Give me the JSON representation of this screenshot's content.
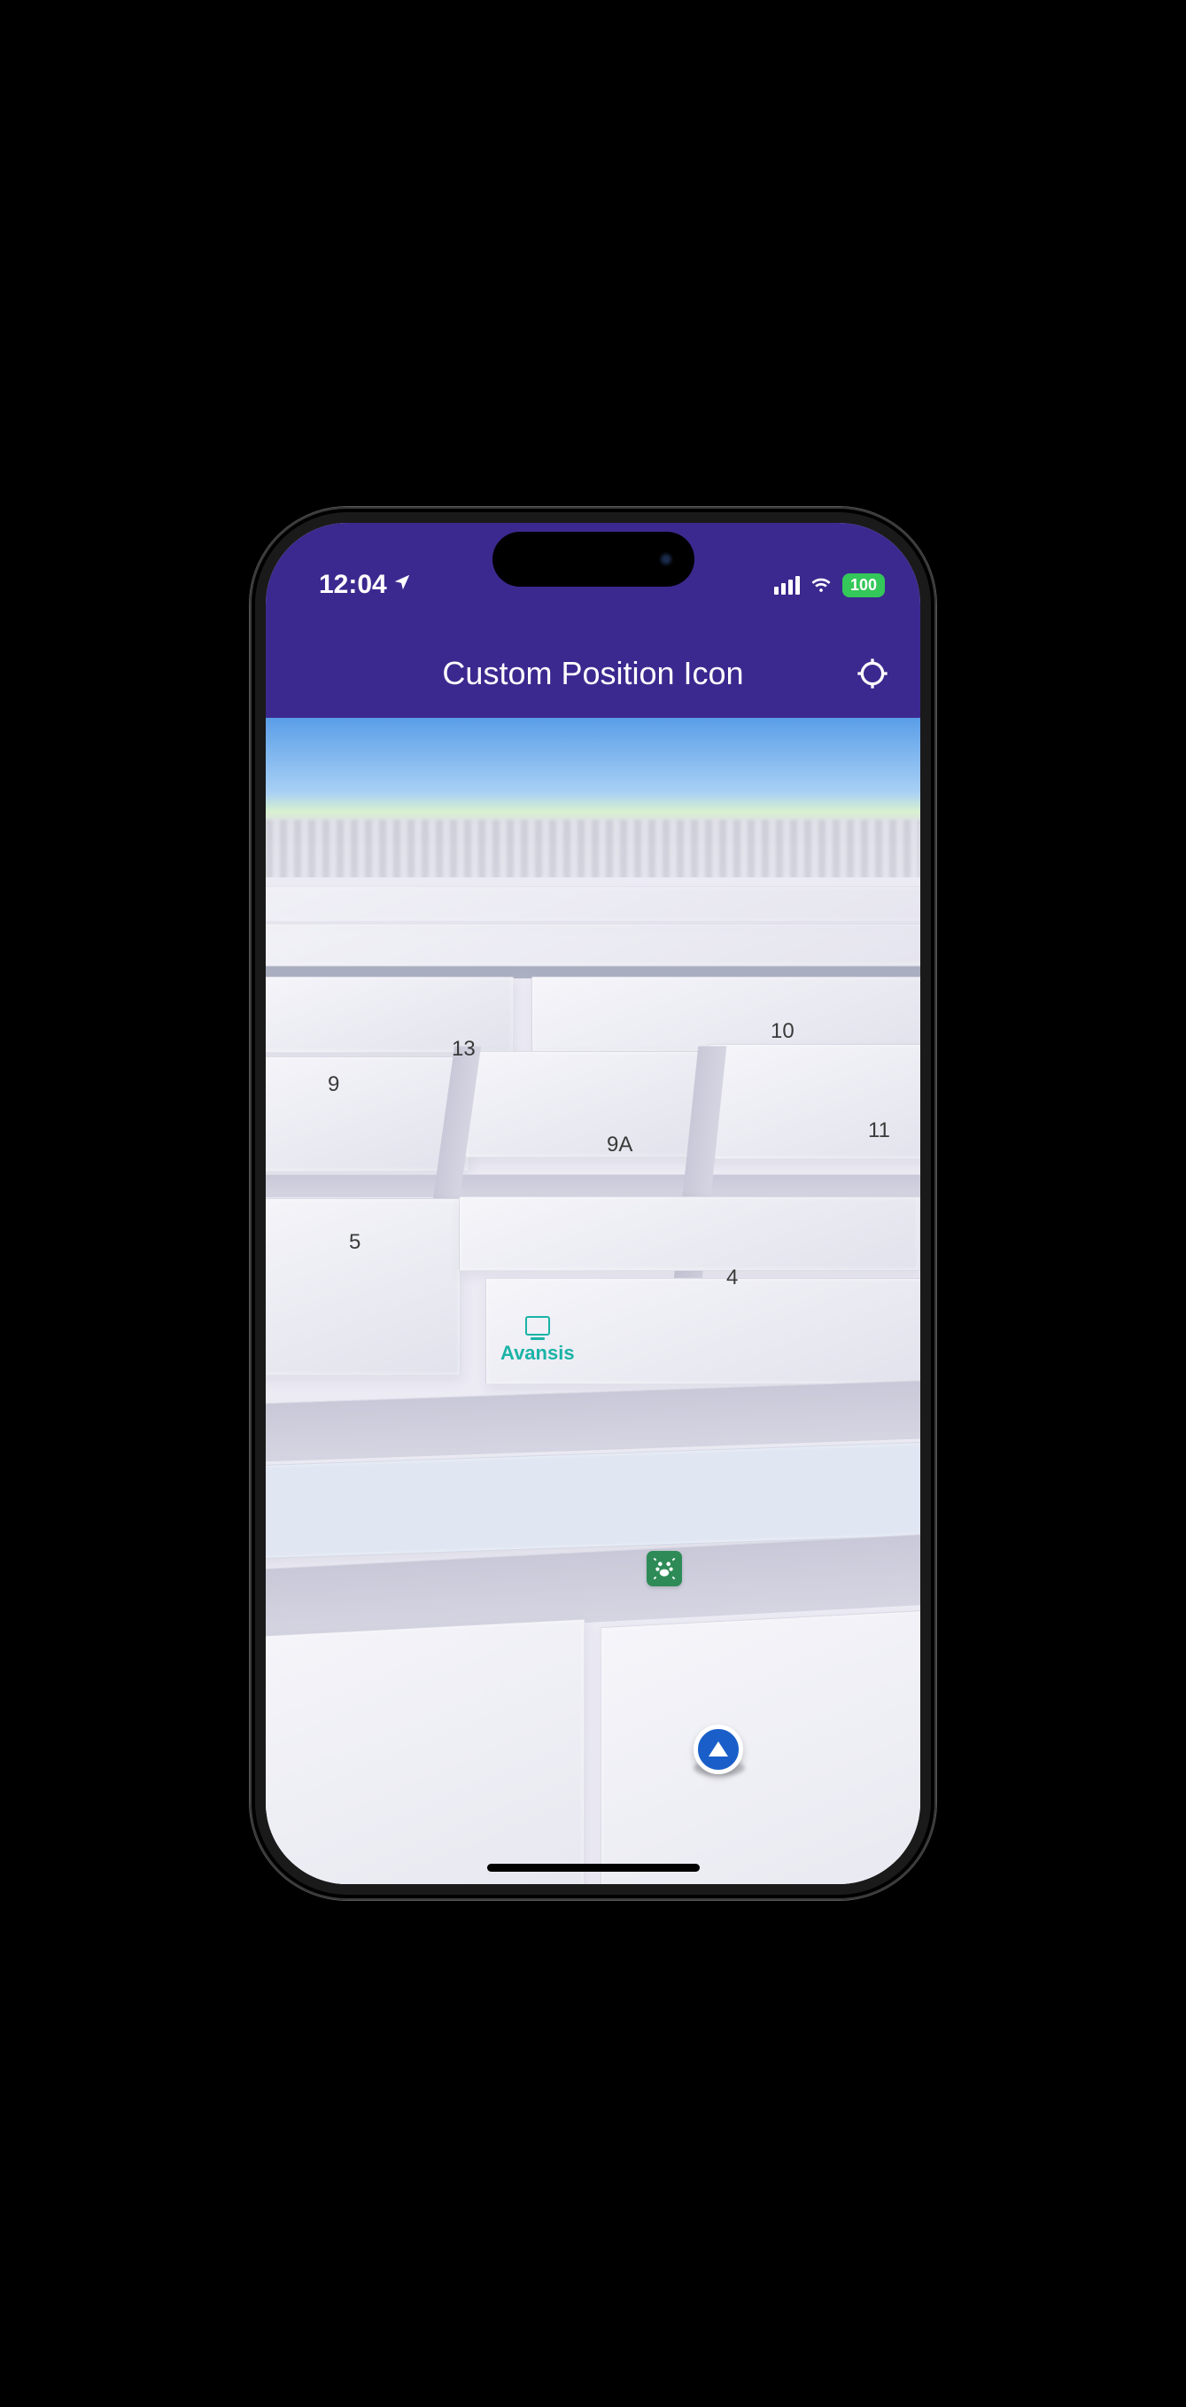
{
  "status": {
    "time": "12:04",
    "battery": "100"
  },
  "header": {
    "title": "Custom Position Icon"
  },
  "map": {
    "poi": {
      "avansis": "Avansis"
    },
    "numbers": {
      "n5": "5",
      "n9": "9",
      "n9a": "9A",
      "n13": "13",
      "n10": "10",
      "n11": "11",
      "n4": "4"
    }
  }
}
